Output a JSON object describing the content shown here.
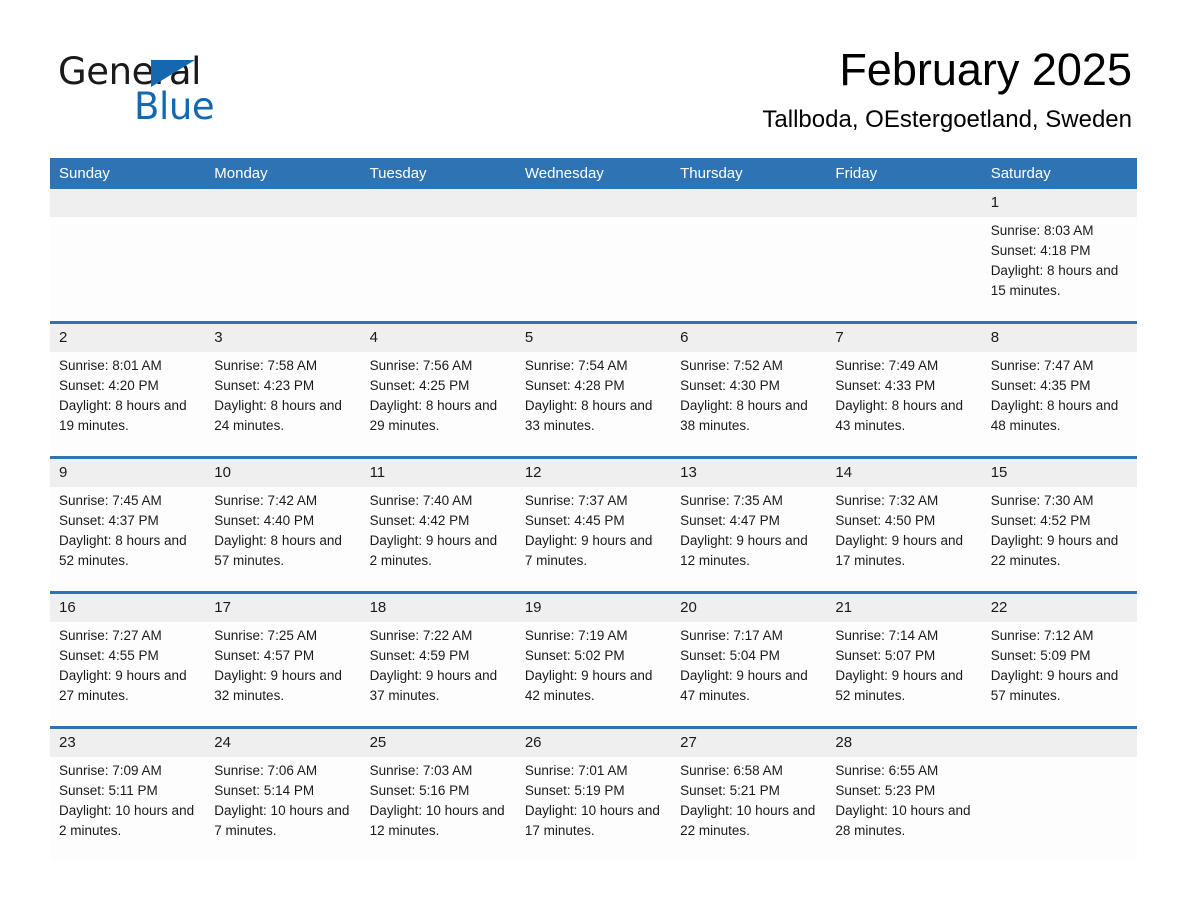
{
  "brand": {
    "name_dark": "General",
    "name_blue": "Blue",
    "accent_color": "#1568b0"
  },
  "header": {
    "title": "February 2025",
    "subtitle": "Tallboda, OEstergoetland, Sweden"
  },
  "calendar": {
    "header_bg": "#2e74b5",
    "daynum_bg": "#efefef",
    "weekdays": [
      "Sunday",
      "Monday",
      "Tuesday",
      "Wednesday",
      "Thursday",
      "Friday",
      "Saturday"
    ],
    "weeks": [
      [
        {
          "day": ""
        },
        {
          "day": ""
        },
        {
          "day": ""
        },
        {
          "day": ""
        },
        {
          "day": ""
        },
        {
          "day": ""
        },
        {
          "day": "1",
          "sunrise": "Sunrise: 8:03 AM",
          "sunset": "Sunset: 4:18 PM",
          "daylight": "Daylight: 8 hours and 15 minutes."
        }
      ],
      [
        {
          "day": "2",
          "sunrise": "Sunrise: 8:01 AM",
          "sunset": "Sunset: 4:20 PM",
          "daylight": "Daylight: 8 hours and 19 minutes."
        },
        {
          "day": "3",
          "sunrise": "Sunrise: 7:58 AM",
          "sunset": "Sunset: 4:23 PM",
          "daylight": "Daylight: 8 hours and 24 minutes."
        },
        {
          "day": "4",
          "sunrise": "Sunrise: 7:56 AM",
          "sunset": "Sunset: 4:25 PM",
          "daylight": "Daylight: 8 hours and 29 minutes."
        },
        {
          "day": "5",
          "sunrise": "Sunrise: 7:54 AM",
          "sunset": "Sunset: 4:28 PM",
          "daylight": "Daylight: 8 hours and 33 minutes."
        },
        {
          "day": "6",
          "sunrise": "Sunrise: 7:52 AM",
          "sunset": "Sunset: 4:30 PM",
          "daylight": "Daylight: 8 hours and 38 minutes."
        },
        {
          "day": "7",
          "sunrise": "Sunrise: 7:49 AM",
          "sunset": "Sunset: 4:33 PM",
          "daylight": "Daylight: 8 hours and 43 minutes."
        },
        {
          "day": "8",
          "sunrise": "Sunrise: 7:47 AM",
          "sunset": "Sunset: 4:35 PM",
          "daylight": "Daylight: 8 hours and 48 minutes."
        }
      ],
      [
        {
          "day": "9",
          "sunrise": "Sunrise: 7:45 AM",
          "sunset": "Sunset: 4:37 PM",
          "daylight": "Daylight: 8 hours and 52 minutes."
        },
        {
          "day": "10",
          "sunrise": "Sunrise: 7:42 AM",
          "sunset": "Sunset: 4:40 PM",
          "daylight": "Daylight: 8 hours and 57 minutes."
        },
        {
          "day": "11",
          "sunrise": "Sunrise: 7:40 AM",
          "sunset": "Sunset: 4:42 PM",
          "daylight": "Daylight: 9 hours and 2 minutes."
        },
        {
          "day": "12",
          "sunrise": "Sunrise: 7:37 AM",
          "sunset": "Sunset: 4:45 PM",
          "daylight": "Daylight: 9 hours and 7 minutes."
        },
        {
          "day": "13",
          "sunrise": "Sunrise: 7:35 AM",
          "sunset": "Sunset: 4:47 PM",
          "daylight": "Daylight: 9 hours and 12 minutes."
        },
        {
          "day": "14",
          "sunrise": "Sunrise: 7:32 AM",
          "sunset": "Sunset: 4:50 PM",
          "daylight": "Daylight: 9 hours and 17 minutes."
        },
        {
          "day": "15",
          "sunrise": "Sunrise: 7:30 AM",
          "sunset": "Sunset: 4:52 PM",
          "daylight": "Daylight: 9 hours and 22 minutes."
        }
      ],
      [
        {
          "day": "16",
          "sunrise": "Sunrise: 7:27 AM",
          "sunset": "Sunset: 4:55 PM",
          "daylight": "Daylight: 9 hours and 27 minutes."
        },
        {
          "day": "17",
          "sunrise": "Sunrise: 7:25 AM",
          "sunset": "Sunset: 4:57 PM",
          "daylight": "Daylight: 9 hours and 32 minutes."
        },
        {
          "day": "18",
          "sunrise": "Sunrise: 7:22 AM",
          "sunset": "Sunset: 4:59 PM",
          "daylight": "Daylight: 9 hours and 37 minutes."
        },
        {
          "day": "19",
          "sunrise": "Sunrise: 7:19 AM",
          "sunset": "Sunset: 5:02 PM",
          "daylight": "Daylight: 9 hours and 42 minutes."
        },
        {
          "day": "20",
          "sunrise": "Sunrise: 7:17 AM",
          "sunset": "Sunset: 5:04 PM",
          "daylight": "Daylight: 9 hours and 47 minutes."
        },
        {
          "day": "21",
          "sunrise": "Sunrise: 7:14 AM",
          "sunset": "Sunset: 5:07 PM",
          "daylight": "Daylight: 9 hours and 52 minutes."
        },
        {
          "day": "22",
          "sunrise": "Sunrise: 7:12 AM",
          "sunset": "Sunset: 5:09 PM",
          "daylight": "Daylight: 9 hours and 57 minutes."
        }
      ],
      [
        {
          "day": "23",
          "sunrise": "Sunrise: 7:09 AM",
          "sunset": "Sunset: 5:11 PM",
          "daylight": "Daylight: 10 hours and 2 minutes."
        },
        {
          "day": "24",
          "sunrise": "Sunrise: 7:06 AM",
          "sunset": "Sunset: 5:14 PM",
          "daylight": "Daylight: 10 hours and 7 minutes."
        },
        {
          "day": "25",
          "sunrise": "Sunrise: 7:03 AM",
          "sunset": "Sunset: 5:16 PM",
          "daylight": "Daylight: 10 hours and 12 minutes."
        },
        {
          "day": "26",
          "sunrise": "Sunrise: 7:01 AM",
          "sunset": "Sunset: 5:19 PM",
          "daylight": "Daylight: 10 hours and 17 minutes."
        },
        {
          "day": "27",
          "sunrise": "Sunrise: 6:58 AM",
          "sunset": "Sunset: 5:21 PM",
          "daylight": "Daylight: 10 hours and 22 minutes."
        },
        {
          "day": "28",
          "sunrise": "Sunrise: 6:55 AM",
          "sunset": "Sunset: 5:23 PM",
          "daylight": "Daylight: 10 hours and 28 minutes."
        },
        {
          "day": ""
        }
      ]
    ]
  }
}
